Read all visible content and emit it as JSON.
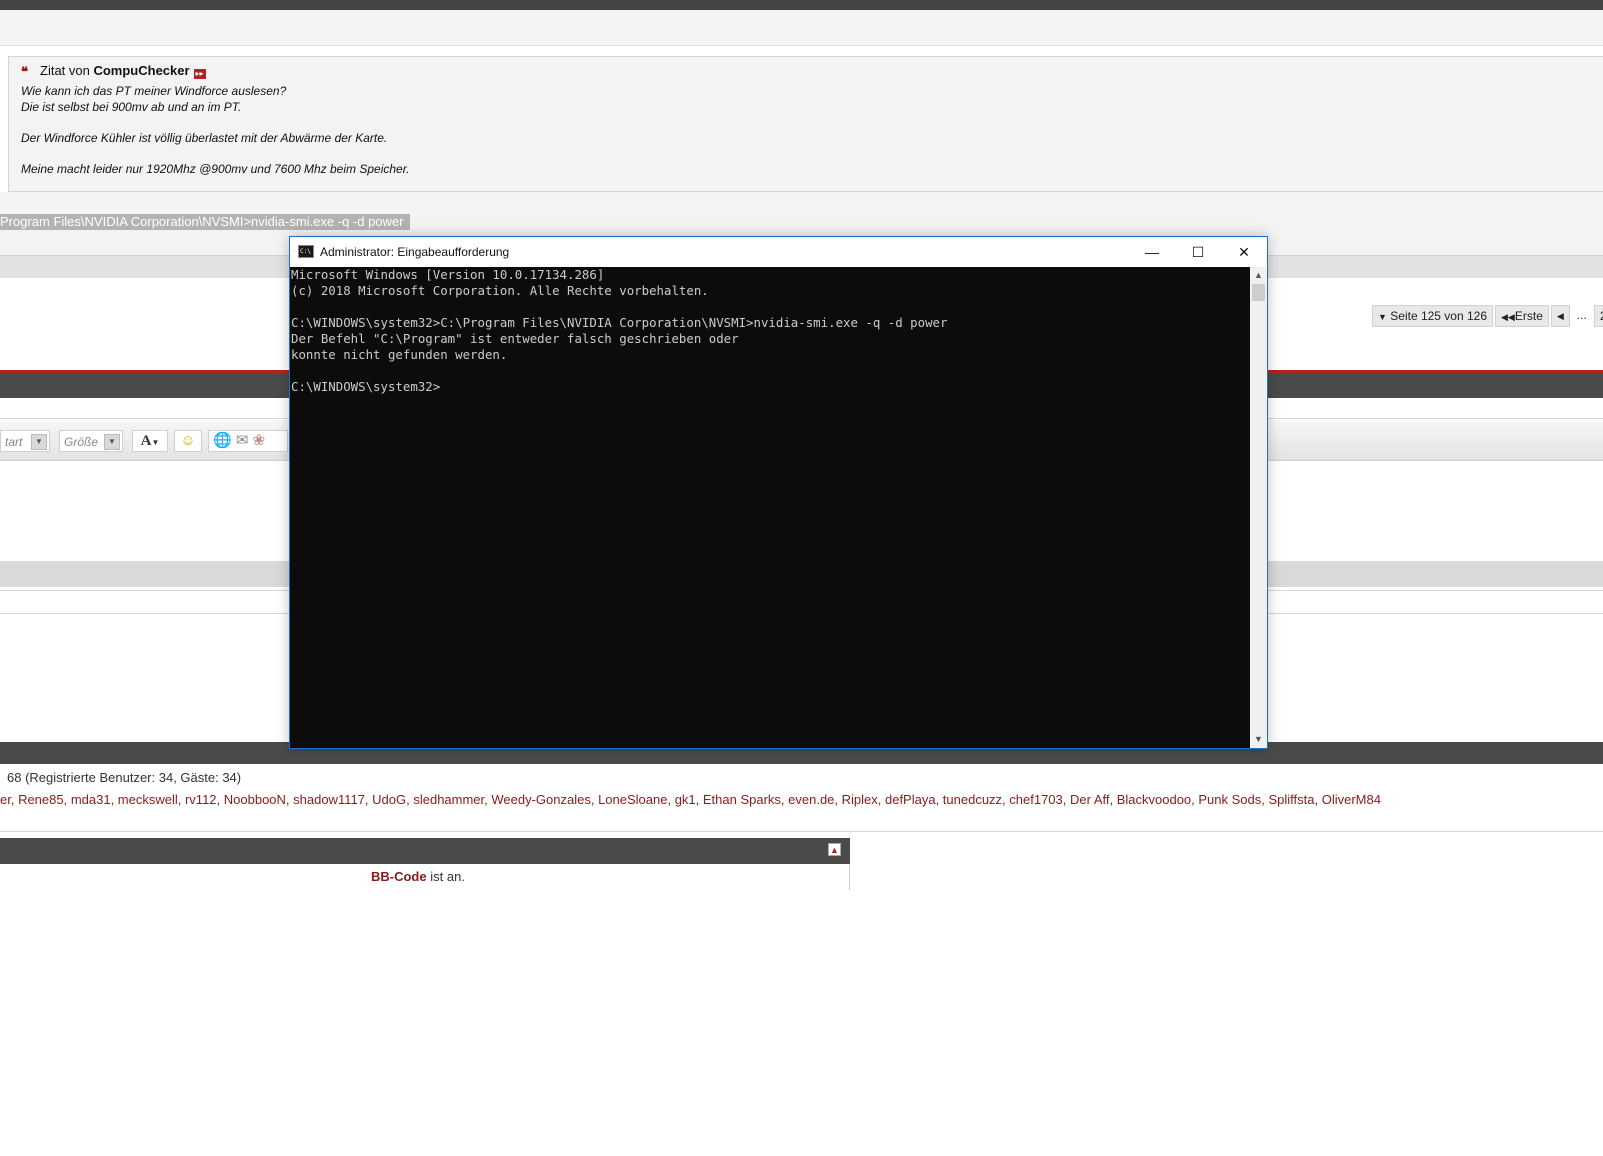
{
  "quote": {
    "prefix": "Zitat von ",
    "author": "CompuChecker",
    "lines": [
      "Wie kann ich das PT meiner Windforce auslesen?",
      "Die ist selbst bei 900mv ab und an im PT.",
      "Der Windforce Kühler ist völlig überlastet mit der Abwärme der Karte.",
      "Meine macht leider nur 1920Mhz @900mv und 7600 Mhz beim Speicher."
    ]
  },
  "post": {
    "selected_command": "Program Files\\NVIDIA Corporation\\NVSMI>nvidia-smi.exe -q -d power"
  },
  "pager": {
    "page_info": "Seite 125 von 126",
    "first": "Erste",
    "prev": "◀",
    "ellipsis": "...",
    "next_partial": "2"
  },
  "editor_toolbar": {
    "font_select": "tart",
    "size_select": "Größe",
    "font_color": "A"
  },
  "online": {
    "count_text": "68 (Registrierte Benutzer: 34, Gäste: 34)",
    "users_text": "er, Rene85, mda31, meckswell, rv112, NoobbooN, shadow1117, UdoG, sledhammer, Weedy-Gonzales, LoneSloane, gk1, Ethan Sparks, even.de, Riplex, defPlaya, tunedcuzz, chef1703, Der Aff, Blackvoodoo, Punk Sods, Spliffsta, OliverM84"
  },
  "bbcode": {
    "label": "BB-Code",
    "status": " ist an."
  },
  "cmd_window": {
    "title": "Administrator: Eingabeaufforderung",
    "icon_text": "C:\\",
    "minimize": "—",
    "maximize": "☐",
    "close": "✕",
    "lines": [
      "Microsoft Windows [Version 10.0.17134.286]",
      "(c) 2018 Microsoft Corporation. Alle Rechte vorbehalten.",
      "",
      "C:\\WINDOWS\\system32>C:\\Program Files\\NVIDIA Corporation\\NVSMI>nvidia-smi.exe -q -d power",
      "Der Befehl \"C:\\Program\" ist entweder falsch geschrieben oder",
      "konnte nicht gefunden werden.",
      "",
      "C:\\WINDOWS\\system32>"
    ]
  },
  "colors": {
    "accent_red": "#b22222",
    "link_red": "#8b1a1a",
    "window_border": "#1c72c4",
    "console_bg": "#0c0c0c"
  }
}
